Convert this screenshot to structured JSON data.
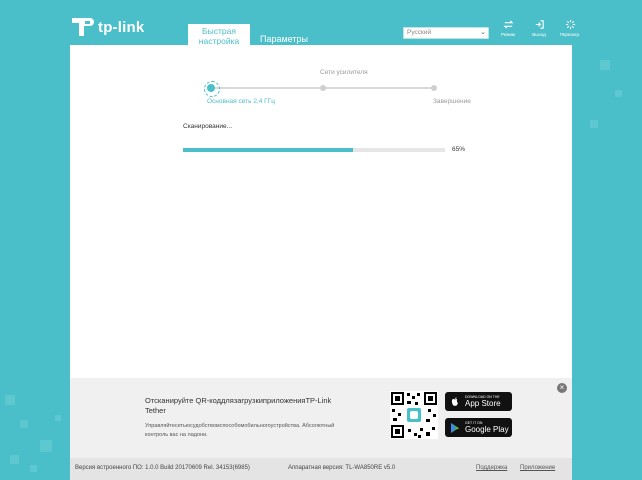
{
  "brand": {
    "logo_text": "tp-link"
  },
  "header": {
    "tabs": [
      {
        "label": "Быстрая настройка",
        "active": true
      },
      {
        "label": "Параметры",
        "active": false
      }
    ],
    "language_select": {
      "value": "Русский"
    },
    "actions": [
      {
        "label": "Режим",
        "icon": "mode-icon"
      },
      {
        "label": "Выход",
        "icon": "logout-icon"
      },
      {
        "label": "Перезагр.",
        "icon": "reboot-icon"
      }
    ]
  },
  "wizard": {
    "steps": [
      {
        "label": "Основная сеть 2,4 ГГц",
        "active": true
      },
      {
        "label": "Сети усилителя",
        "active": false
      },
      {
        "label": "Завершение",
        "active": false
      }
    ],
    "scan_label": "Сканирование...",
    "progress_percent": 65,
    "progress_text": "65%"
  },
  "app_banner": {
    "title": "Отсканируйте QR-коддлязагрузкиприложенияTP-Link Tether",
    "description": "Управляйтесетьюсудобствомспособомобильногоустройства. Абсолютный контроль вас на ладони.",
    "app_store": {
      "small": "DOWNLOAD ON THE",
      "big": "App Store"
    },
    "google_play": {
      "small": "GET IT ON",
      "big": "Google Play"
    },
    "close_icon": "close-icon"
  },
  "footer": {
    "firmware": "Версия встроенного ПО: 1.0.0 Build 20170609 Rel. 34153(6985)",
    "hardware": "Аппаратная версия: TL-WA850RE v5.0",
    "support_link": "Поддержка",
    "app_link": "Приложение"
  },
  "colors": {
    "accent": "#4bbfc9",
    "panel": "#ffffff",
    "banner": "#f0f0f0",
    "footer": "#e4e4e4"
  }
}
